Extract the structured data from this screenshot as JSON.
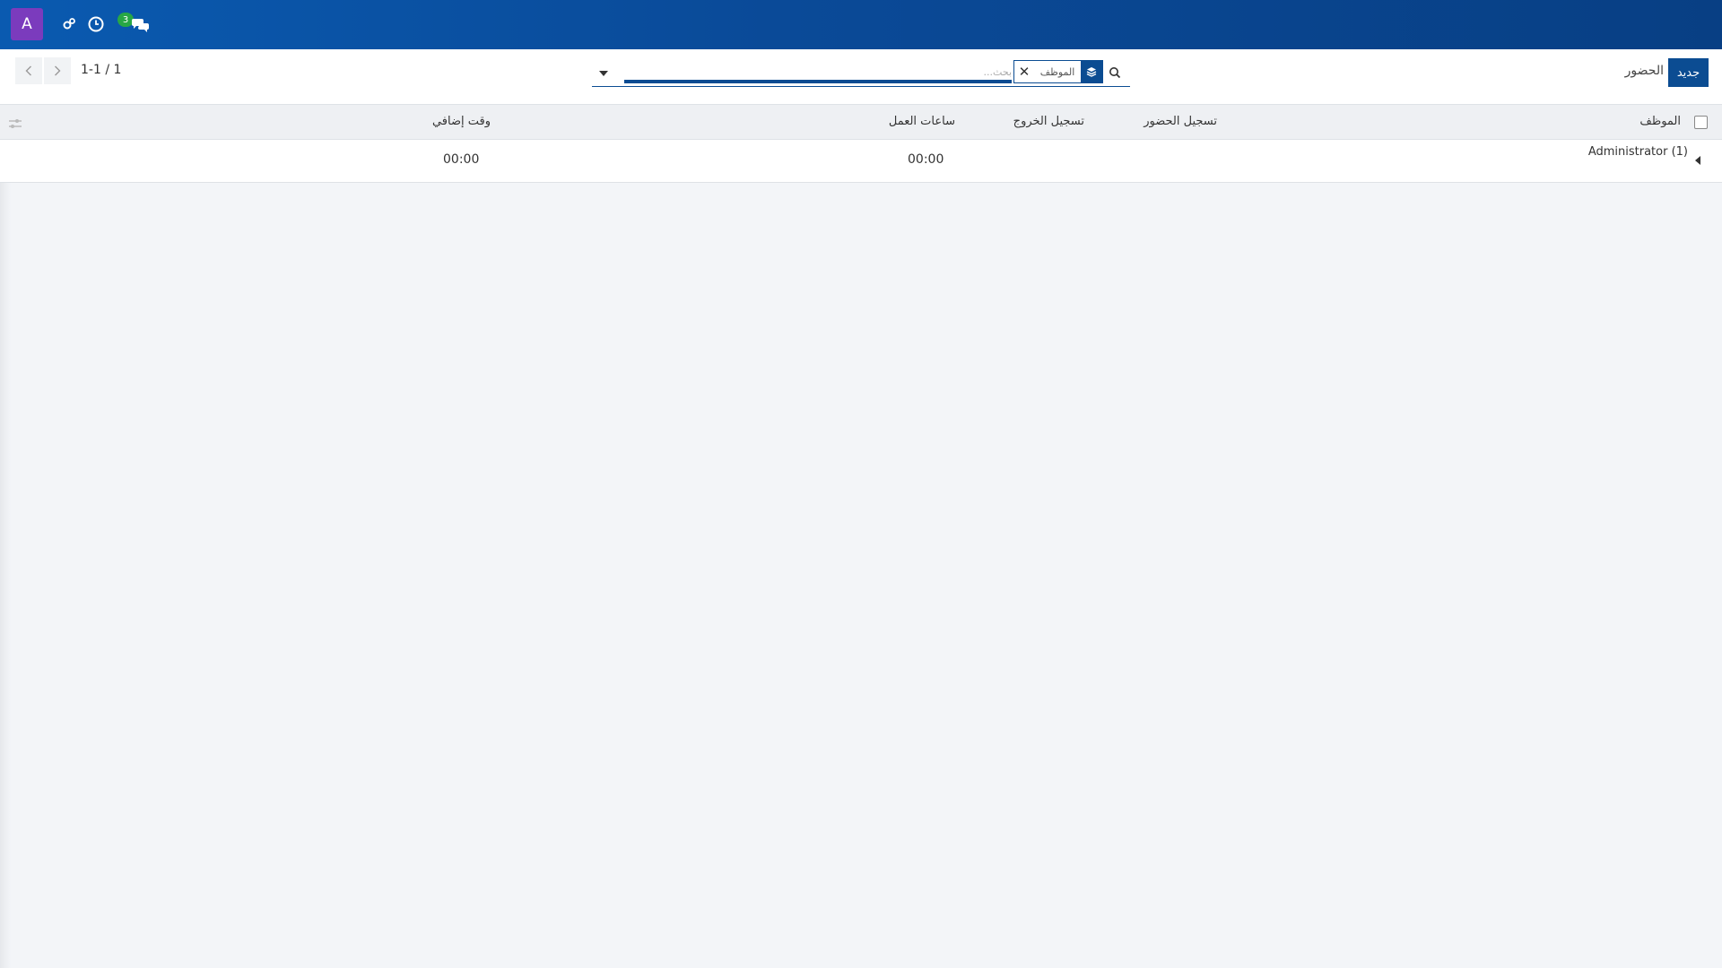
{
  "navbar": {
    "avatar_letter": "A",
    "icons": [
      "gear-icon",
      "clock-icon",
      "chat-icon"
    ],
    "chat_badge": "3"
  },
  "control": {
    "new_button": "جديد",
    "breadcrumb": "الحضور",
    "search": {
      "placeholder": "بحث...",
      "facet_label": "الموظف"
    },
    "pager": "1-1 / 1"
  },
  "table": {
    "headers": {
      "employee": "الموظف",
      "check_in": "تسجيل الحضور",
      "check_out": "تسجيل الخروج",
      "worked_hours": "ساعات العمل",
      "overtime": "وقت إضافي"
    },
    "groups": [
      {
        "label": "Administrator (1)",
        "worked_hours": "00:00",
        "overtime": "00:00"
      }
    ]
  },
  "colors": {
    "navbar": "#0a4a98",
    "primary": "#0b4c92",
    "avatar": "#7b3bbd",
    "badge": "#28a745"
  }
}
